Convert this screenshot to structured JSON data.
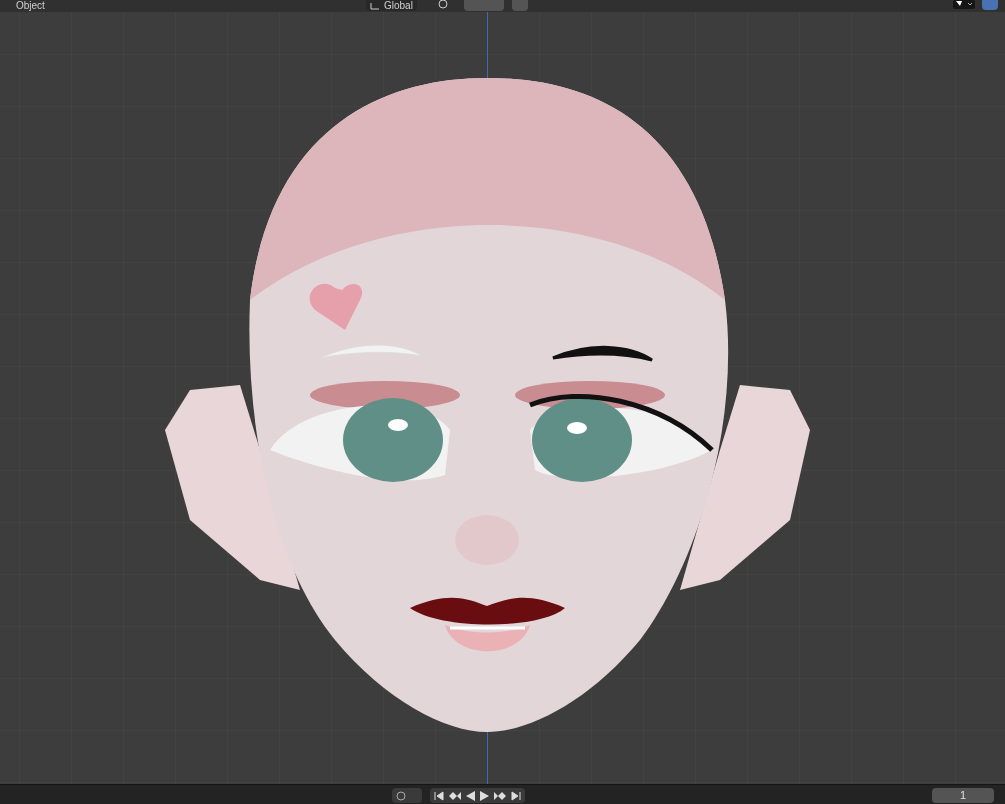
{
  "header": {
    "mode_label": "Object",
    "orientation": "Global"
  },
  "toggles": {
    "snap": {
      "on": false
    },
    "proportional_edit": {
      "on": false
    },
    "overlays": {
      "on": true
    }
  },
  "timeline": {
    "current_frame": "1"
  }
}
